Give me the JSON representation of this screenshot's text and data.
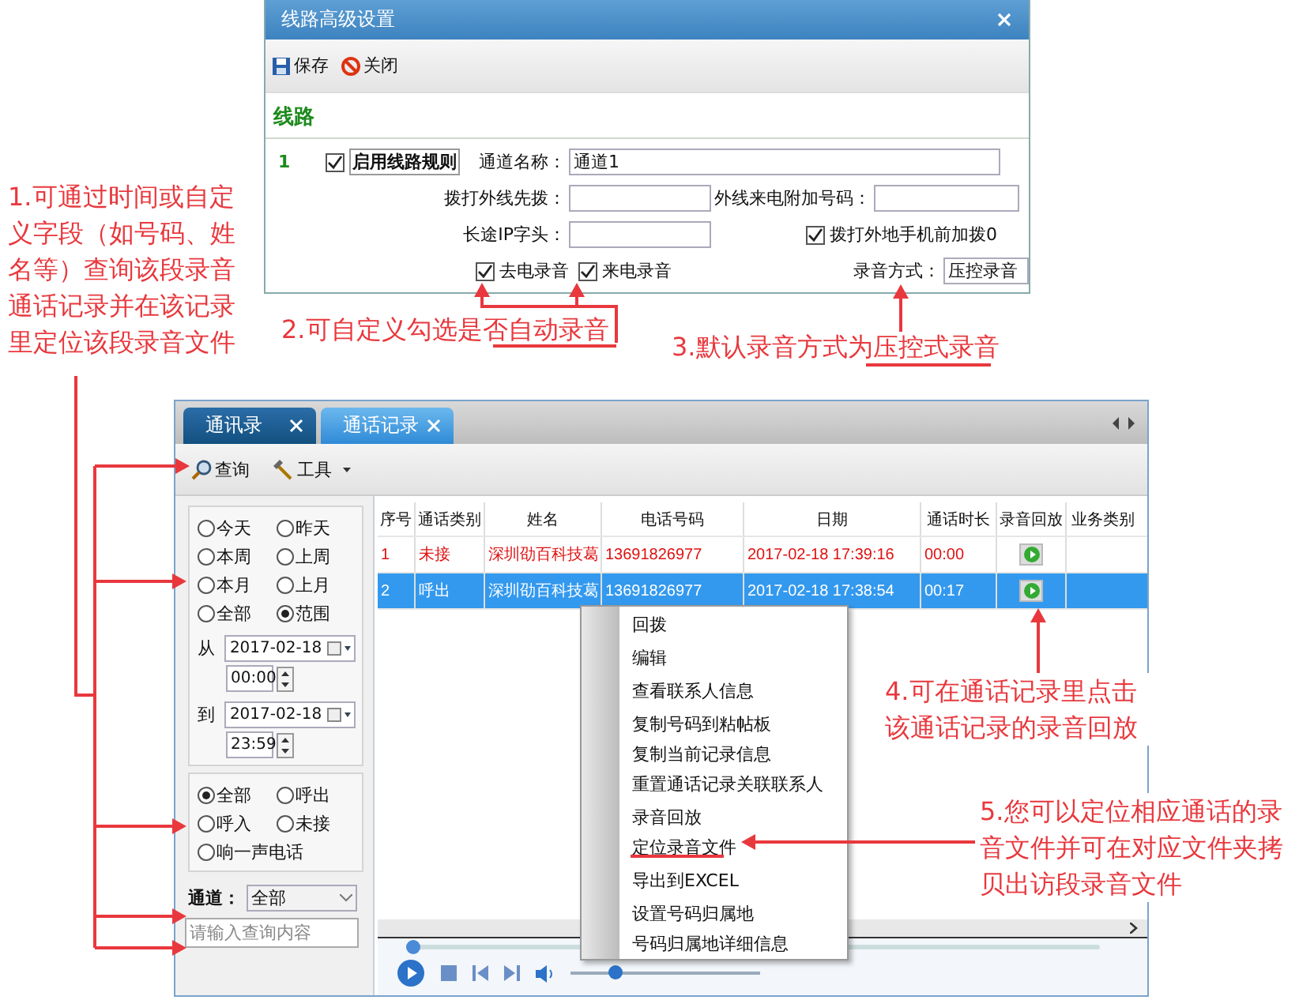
{
  "dialog": {
    "title": "线路高级设置",
    "toolbar": [
      {
        "label": "保存",
        "kind": "save"
      },
      {
        "label": "关闭",
        "kind": "close"
      }
    ],
    "section_title": "线路",
    "row_number": "1",
    "enable_rule": {
      "label": "启用线路规则",
      "checked": true
    },
    "channel_name": {
      "label": "通道名称：",
      "value": "通道1"
    },
    "dial_prefix": {
      "label": "拨打外线先拨："
    },
    "incoming_extra": {
      "label": "外线来电附加号码："
    },
    "ip_prefix": {
      "label": "长途IP字头："
    },
    "mobile_prefix_zero": {
      "label": "拨打外地手机前加拨0",
      "checked": true
    },
    "record_outgoing": {
      "label": "去电录音",
      "checked": true
    },
    "record_incoming": {
      "label": "来电录音",
      "checked": true
    },
    "record_mode": {
      "label": "录音方式：",
      "value": "压控录音"
    }
  },
  "app": {
    "tabs": [
      {
        "label": "通讯录",
        "selected": false
      },
      {
        "label": "通话记录",
        "selected": true
      }
    ],
    "toolbar": [
      {
        "label": "查询",
        "kind": "search"
      },
      {
        "label": "工具",
        "kind": "tools"
      }
    ],
    "time_range": [
      {
        "label": "今天",
        "selected": false
      },
      {
        "label": "昨天",
        "selected": false
      },
      {
        "label": "本周",
        "selected": false
      },
      {
        "label": "上周",
        "selected": false
      },
      {
        "label": "本月",
        "selected": false
      },
      {
        "label": "上月",
        "selected": false
      },
      {
        "label": "全部",
        "selected": false
      },
      {
        "label": "范围",
        "selected": true
      }
    ],
    "date_from": {
      "label": "从",
      "date": "2017-02-18",
      "time": "00:00"
    },
    "date_to": {
      "label": "到",
      "date": "2017-02-18",
      "time": "23:59"
    },
    "call_type": [
      {
        "label": "全部",
        "selected": true
      },
      {
        "label": "呼出",
        "selected": false
      },
      {
        "label": "呼入",
        "selected": false
      },
      {
        "label": "未接",
        "selected": false
      },
      {
        "label": "响一声电话",
        "selected": false
      }
    ],
    "channel": {
      "label": "通道：",
      "value": "全部"
    },
    "search": {
      "placeholder": "请输入查询内容"
    },
    "table": {
      "columns": [
        "序号",
        "通话类别",
        "姓名",
        "电话号码",
        "日期",
        "通话时长",
        "录音回放",
        "业务类别"
      ],
      "rows": [
        {
          "cells": [
            "1",
            "未接",
            "深圳劭百科技葛",
            "13691826977",
            "2017-02-18  17:39:16",
            "00:00"
          ],
          "missed": true,
          "selected": false
        },
        {
          "cells": [
            "2",
            "呼出",
            "深圳劭百科技葛",
            "13691826977",
            "2017-02-18  17:38:54",
            "00:17"
          ],
          "missed": false,
          "selected": true
        }
      ]
    },
    "context_menu": [
      [
        {
          "label": "回拨"
        }
      ],
      [
        {
          "label": "编辑"
        }
      ],
      [
        {
          "label": "查看联系人信息"
        }
      ],
      [
        {
          "label": "复制号码到粘帖板"
        },
        {
          "label": "复制当前记录信息"
        },
        {
          "label": "重置通话记录关联联系人"
        }
      ],
      [
        {
          "label": "录音回放"
        },
        {
          "label": "定位录音文件"
        }
      ],
      [
        {
          "label": "导出到EXCEL"
        }
      ],
      [
        {
          "label": "设置号码归属地"
        },
        {
          "label": "号码归属地详细信息"
        }
      ]
    ],
    "player": {
      "progress": {
        "level": 0
      },
      "volume": {
        "level": 0.2
      }
    }
  },
  "annotations": [
    {
      "text": "1.可通过时间或自定义字段（如号码、姓名等）查询该段录音通话记录并在该记录里定位该段录音文件"
    },
    {
      "text": "2.可自定义勾选是否自动录音"
    },
    {
      "text": "3.默认录音方式为压控式录音"
    },
    {
      "text": "4.可在通话记录里点击该通话记录的录音回放"
    },
    {
      "text": "5.您可以定位相应通话的录音文件并可在对应文件夹拷贝出访段录音文件"
    }
  ]
}
